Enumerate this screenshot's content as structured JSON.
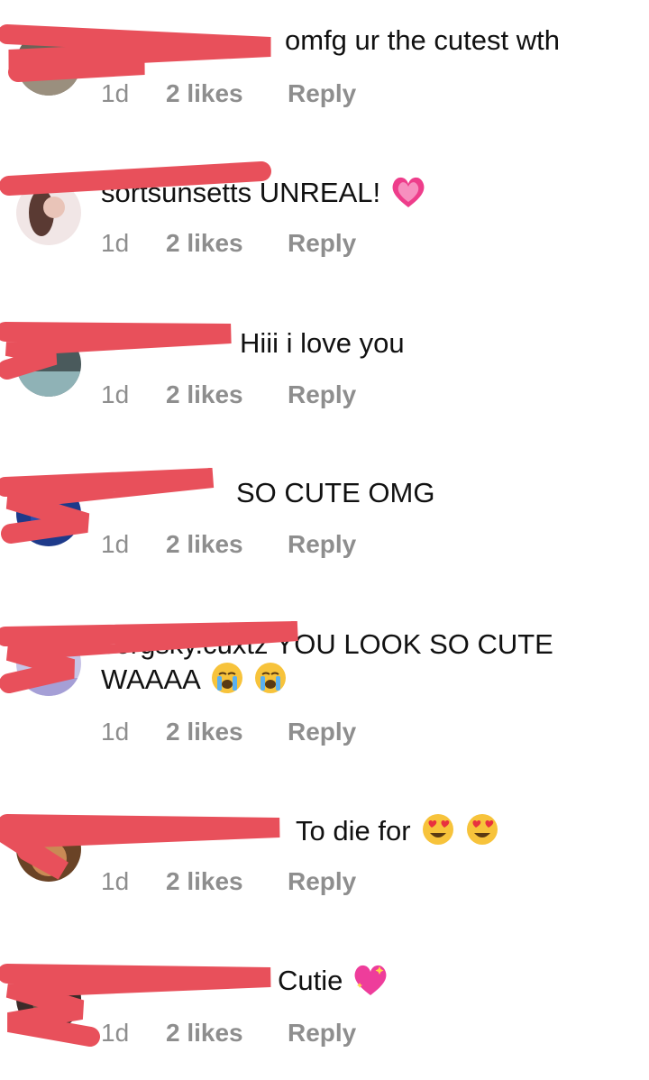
{
  "colors": {
    "text": "#111111",
    "meta": "#8e8e8e",
    "redaction": "#e8505b"
  },
  "comments": [
    {
      "text": "omfg ur the cutest wth",
      "time": "1d",
      "likes": "2 likes",
      "reply": "Reply",
      "emoji": []
    },
    {
      "text": "sortsunsetts UNREAL!",
      "time": "1d",
      "likes": "2 likes",
      "reply": "Reply",
      "emoji": [
        "growing-heart-icon"
      ]
    },
    {
      "text": "Hiii i love you",
      "time": "1d",
      "likes": "2 likes",
      "reply": "Reply",
      "emoji": []
    },
    {
      "text": "SO CUTE OMG",
      "time": "1d",
      "likes": "2 likes",
      "reply": "Reply",
      "emoji": []
    },
    {
      "text": "corgsky.cuxtz YOU LOOK SO CUTE WAAAA",
      "time": "1d",
      "likes": "2 likes",
      "reply": "Reply",
      "emoji": [
        "crying-face-icon",
        "crying-face-icon"
      ]
    },
    {
      "text": "To die for",
      "time": "1d",
      "likes": "2 likes",
      "reply": "Reply",
      "emoji": [
        "heart-eyes-icon",
        "heart-eyes-icon"
      ]
    },
    {
      "text": "Cutie",
      "time": "1d",
      "likes": "2 likes",
      "reply": "Reply",
      "emoji": [
        "sparkling-heart-icon"
      ]
    }
  ]
}
